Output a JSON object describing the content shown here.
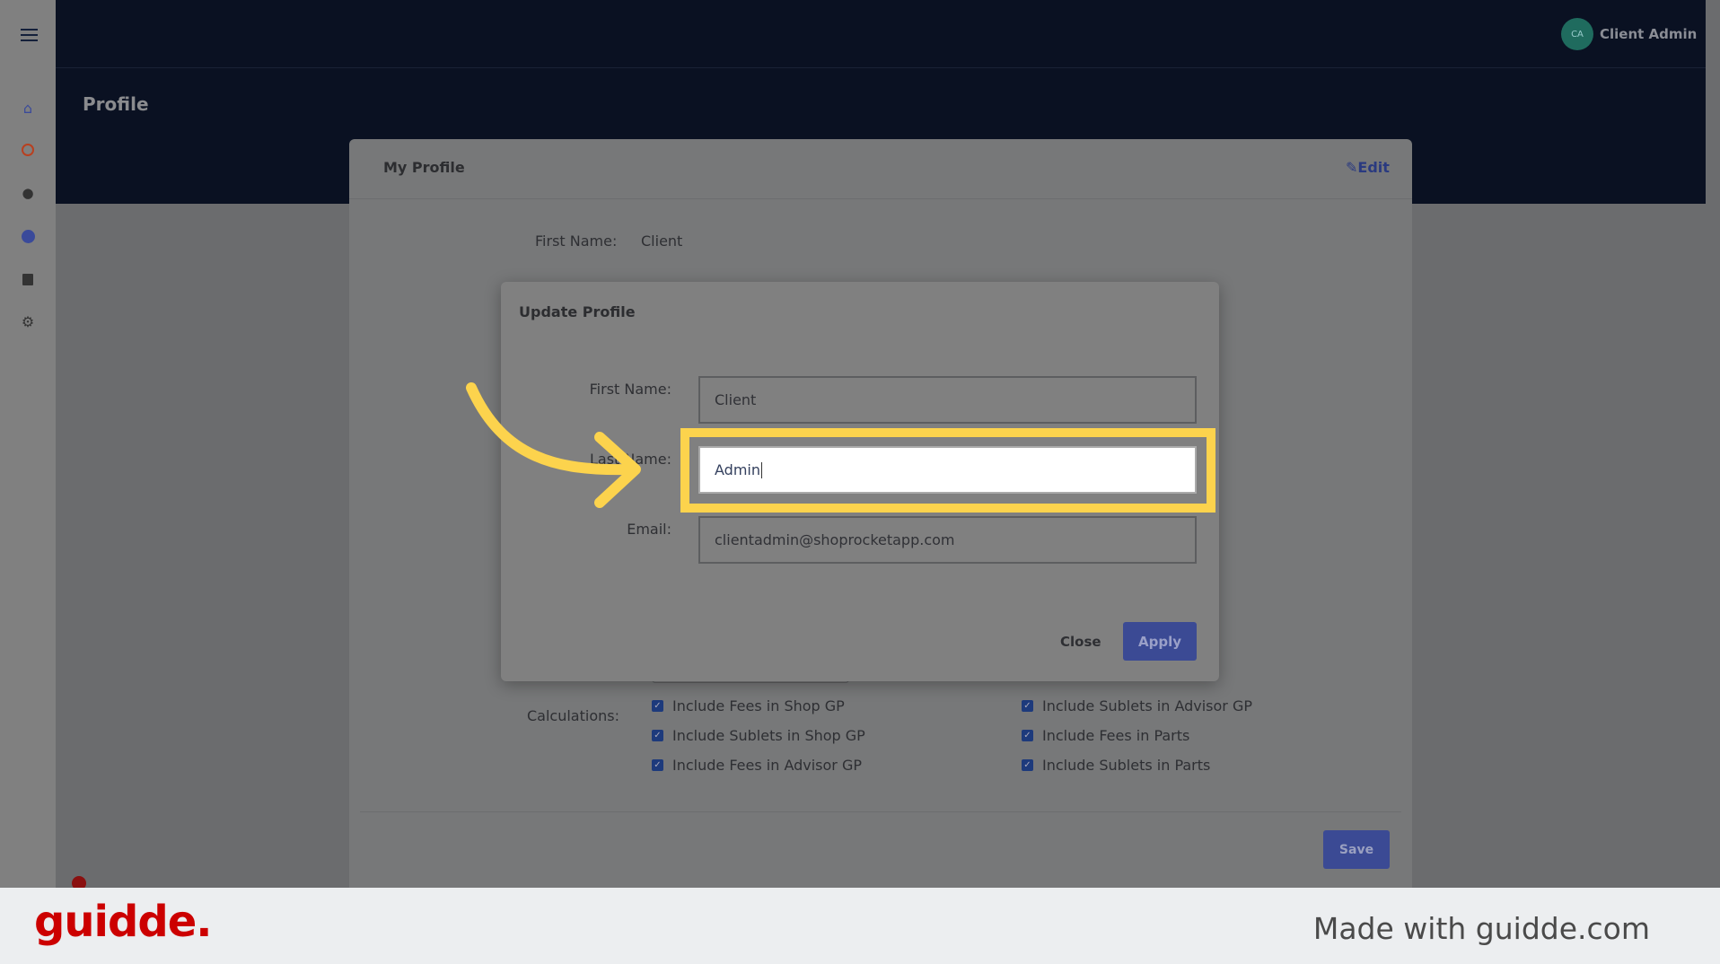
{
  "header": {
    "page_title": "Profile",
    "user_initials": "CA",
    "user_name": "Client Admin"
  },
  "sidebar": {
    "items": [
      {
        "icon": "store-icon"
      },
      {
        "icon": "compass-icon"
      },
      {
        "icon": "user-icon"
      },
      {
        "icon": "pie-chart-icon"
      },
      {
        "icon": "archive-icon"
      },
      {
        "icon": "gear-icon"
      }
    ]
  },
  "card": {
    "title": "My Profile",
    "edit_label": "Edit",
    "first_name_label": "First Name:",
    "first_name_value": "Client",
    "calculations_label": "Calculations:",
    "checkboxes": [
      {
        "label": "Include Fees in Shop GP",
        "checked": true
      },
      {
        "label": "Include Sublets in Shop GP",
        "checked": true
      },
      {
        "label": "Include Fees in Advisor GP",
        "checked": true
      },
      {
        "label": "Include Sublets in Advisor GP",
        "checked": true
      },
      {
        "label": "Include Fees in Parts",
        "checked": true
      },
      {
        "label": "Include Sublets in Parts",
        "checked": true
      }
    ],
    "save_label": "Save"
  },
  "modal": {
    "title": "Update Profile",
    "first_name_label": "First Name:",
    "first_name_value": "Client",
    "last_name_label": "Last Name:",
    "last_name_value": "Admin",
    "email_label": "Email:",
    "email_value": "clientadmin@shoprocketapp.com",
    "close_label": "Close",
    "apply_label": "Apply"
  },
  "footer": {
    "logo": "guidde.",
    "tagline": "Made with guidde.com"
  },
  "colors": {
    "accent": "#3b4a94",
    "highlight": "#fcd34d",
    "header": "#0a1122",
    "logo": "#cc0000"
  }
}
